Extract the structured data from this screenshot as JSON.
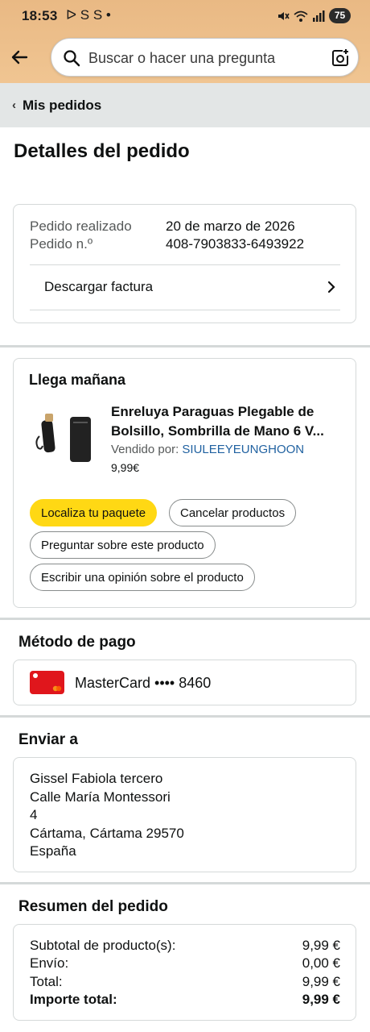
{
  "status_bar": {
    "time": "18:53",
    "notification_icons": "ᐅ S S •",
    "battery": "75",
    "icons": [
      "mute-icon",
      "wifi-icon",
      "signal-icon"
    ]
  },
  "header": {
    "search_placeholder": "Buscar o hacer una pregunta",
    "icons": [
      "back-arrow-icon",
      "search-icon",
      "camera-icon"
    ]
  },
  "breadcrumb": {
    "label": "Mis pedidos"
  },
  "page": {
    "title": "Detalles del pedido"
  },
  "order_info": {
    "placed_label": "Pedido realizado",
    "placed_value": "20 de marzo de 2026",
    "number_label": "Pedido n.º",
    "number_value": "408-7903833-6493922",
    "invoice_label": "Descargar factura"
  },
  "shipment": {
    "status": "Llega mañana",
    "product_title": "Enreluya Paraguas Plegable de Bolsillo, Sombrilla de Mano 6 V...",
    "seller_prefix": "Vendido por: ",
    "seller_name": "SIULEEYEUNGHOON",
    "price": "9,99€",
    "buttons": {
      "track": "Localiza tu paquete",
      "cancel": "Cancelar productos",
      "ask": "Preguntar sobre este producto",
      "review": "Escribir una opinión sobre el producto"
    }
  },
  "payment": {
    "heading": "Método de pago",
    "method": "MasterCard •••• 8460"
  },
  "shipping": {
    "heading": "Enviar a",
    "lines": [
      "Gissel Fabiola tercero",
      "Calle María Montessori",
      "4",
      "Cártama, Cártama 29570",
      "España"
    ]
  },
  "summary": {
    "heading": "Resumen del pedido",
    "rows": [
      {
        "label": "Subtotal de producto(s):",
        "value": "9,99 €"
      },
      {
        "label": "Envío:",
        "value": "0,00 €"
      },
      {
        "label": "Total:",
        "value": "9,99 €"
      },
      {
        "label": "Importe total:",
        "value": "9,99 €"
      }
    ]
  },
  "colors": {
    "header_bg": "#f0c592",
    "primary_button": "#ffd814",
    "link": "#2162a1",
    "card_red": "#e0161c"
  }
}
